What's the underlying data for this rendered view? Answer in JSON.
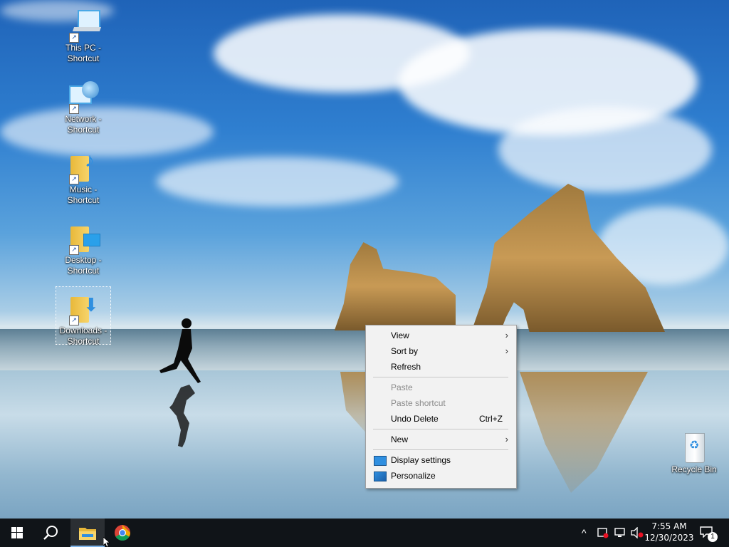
{
  "desktop_icons": [
    {
      "label": "This PC - Shortcut",
      "icon": "this-pc-icon"
    },
    {
      "label": "Network - Shortcut",
      "icon": "network-icon"
    },
    {
      "label": "Music - Shortcut",
      "icon": "music-folder-icon"
    },
    {
      "label": "Desktop - Shortcut",
      "icon": "desktop-folder-icon"
    },
    {
      "label": "Downloads - Shortcut",
      "icon": "downloads-folder-icon"
    },
    {
      "label": "Recycle Bin",
      "icon": "recycle-bin-icon"
    }
  ],
  "context_menu": {
    "items": [
      {
        "label": "View",
        "submenu": true,
        "disabled": false
      },
      {
        "label": "Sort by",
        "submenu": true,
        "disabled": false
      },
      {
        "label": "Refresh",
        "disabled": false
      },
      {
        "label": "Paste",
        "disabled": true
      },
      {
        "label": "Paste shortcut",
        "disabled": true
      },
      {
        "label": "Undo Delete",
        "shortcut": "Ctrl+Z",
        "disabled": false
      },
      {
        "label": "New",
        "submenu": true,
        "disabled": false
      },
      {
        "label": "Display settings",
        "icon": "display-settings-icon",
        "disabled": false
      },
      {
        "label": "Personalize",
        "icon": "personalize-icon",
        "disabled": false
      }
    ],
    "submenu_arrow": "›"
  },
  "taskbar": {
    "start": "windows-start-icon",
    "search": "search-icon",
    "apps": [
      {
        "name": "File Explorer",
        "icon": "file-explorer-icon",
        "active": true
      },
      {
        "name": "Google Chrome",
        "icon": "chrome-icon",
        "active": false
      }
    ],
    "tray": {
      "chevron": "^",
      "time": "7:55 AM",
      "date": "12/30/2023",
      "notification_count": "1"
    }
  },
  "colors": {
    "taskbar_bg": "#101418",
    "menu_bg": "#f2f2f2",
    "accent": "#7fb4e8"
  }
}
